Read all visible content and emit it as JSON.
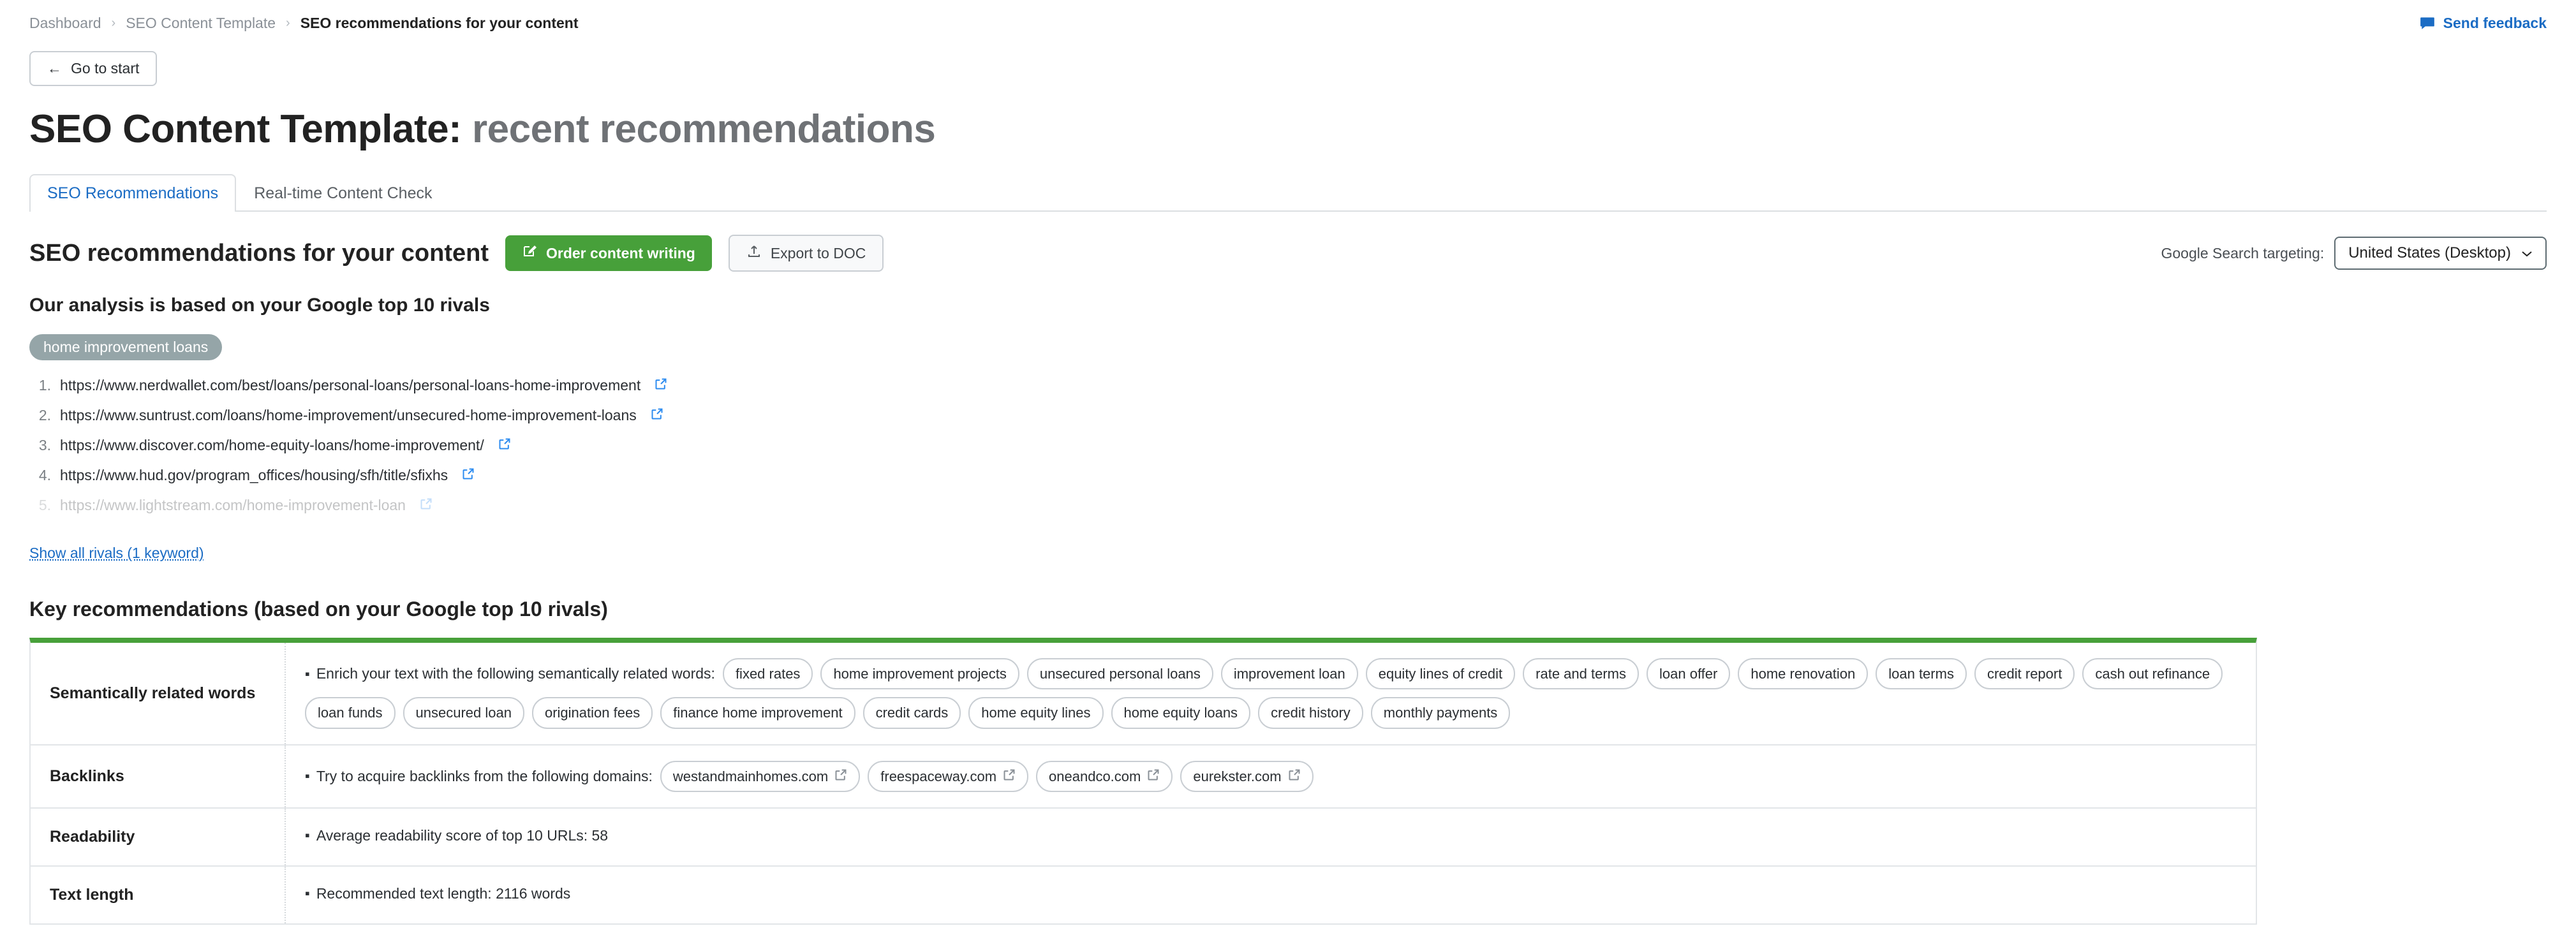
{
  "breadcrumb": {
    "items": [
      "Dashboard",
      "SEO Content Template",
      "SEO recommendations for your content"
    ],
    "separator": "›"
  },
  "feedback": {
    "label": "Send feedback"
  },
  "back_button": {
    "label": "Go to start",
    "arrow": "←"
  },
  "page_title": {
    "main": "SEO Content Template:",
    "sub": "recent recommendations"
  },
  "tabs": [
    {
      "label": "SEO Recommendations",
      "active": true
    },
    {
      "label": "Real-time Content Check",
      "active": false
    }
  ],
  "section": {
    "title": "SEO recommendations for your content",
    "order_button": "Order content writing",
    "export_button": "Export to DOC",
    "targeting_label": "Google Search targeting:",
    "targeting_value": "United States (Desktop)"
  },
  "analysis": {
    "subtitle": "Our analysis is based on your Google top 10 rivals",
    "keyword": "home improvement loans",
    "urls": [
      {
        "n": "1.",
        "url": "https://www.nerdwallet.com/best/loans/personal-loans/personal-loans-home-improvement",
        "faded": false
      },
      {
        "n": "2.",
        "url": "https://www.suntrust.com/loans/home-improvement/unsecured-home-improvement-loans",
        "faded": false
      },
      {
        "n": "3.",
        "url": "https://www.discover.com/home-equity-loans/home-improvement/",
        "faded": false
      },
      {
        "n": "4.",
        "url": "https://www.hud.gov/program_offices/housing/sfh/title/sfixhs",
        "faded": false
      },
      {
        "n": "5.",
        "url": "https://www.lightstream.com/home-improvement-loan",
        "faded": true
      }
    ],
    "show_all": "Show all rivals (1 keyword)"
  },
  "key_recommendations": {
    "heading": "Key recommendations (based on your Google top 10 rivals)",
    "rows": [
      {
        "label": "Semantically related words",
        "text": "Enrich your text with the following semantically related words:",
        "chips": [
          "fixed rates",
          "home improvement projects",
          "unsecured personal loans",
          "improvement loan",
          "equity lines of credit",
          "rate and terms",
          "loan offer",
          "home renovation",
          "loan terms",
          "credit report",
          "cash out refinance",
          "loan funds",
          "unsecured loan",
          "origination fees",
          "finance home improvement",
          "credit cards",
          "home equity lines",
          "home equity loans",
          "credit history",
          "monthly payments"
        ]
      },
      {
        "label": "Backlinks",
        "text": "Try to acquire backlinks from the following domains:",
        "chips": [
          "westandmainhomes.com",
          "freespaceway.com",
          "oneandco.com",
          "eurekster.com"
        ]
      },
      {
        "label": "Readability",
        "text": "Average readability score of top 10 URLs:  58",
        "chips": []
      },
      {
        "label": "Text length",
        "text": "Recommended text length: 2116 words",
        "chips": []
      }
    ]
  },
  "colors": {
    "accent_green": "#47a03a",
    "link_blue": "#1b6cc4",
    "chip_gray": "#95a5a8",
    "border": "#e2e5e8"
  }
}
